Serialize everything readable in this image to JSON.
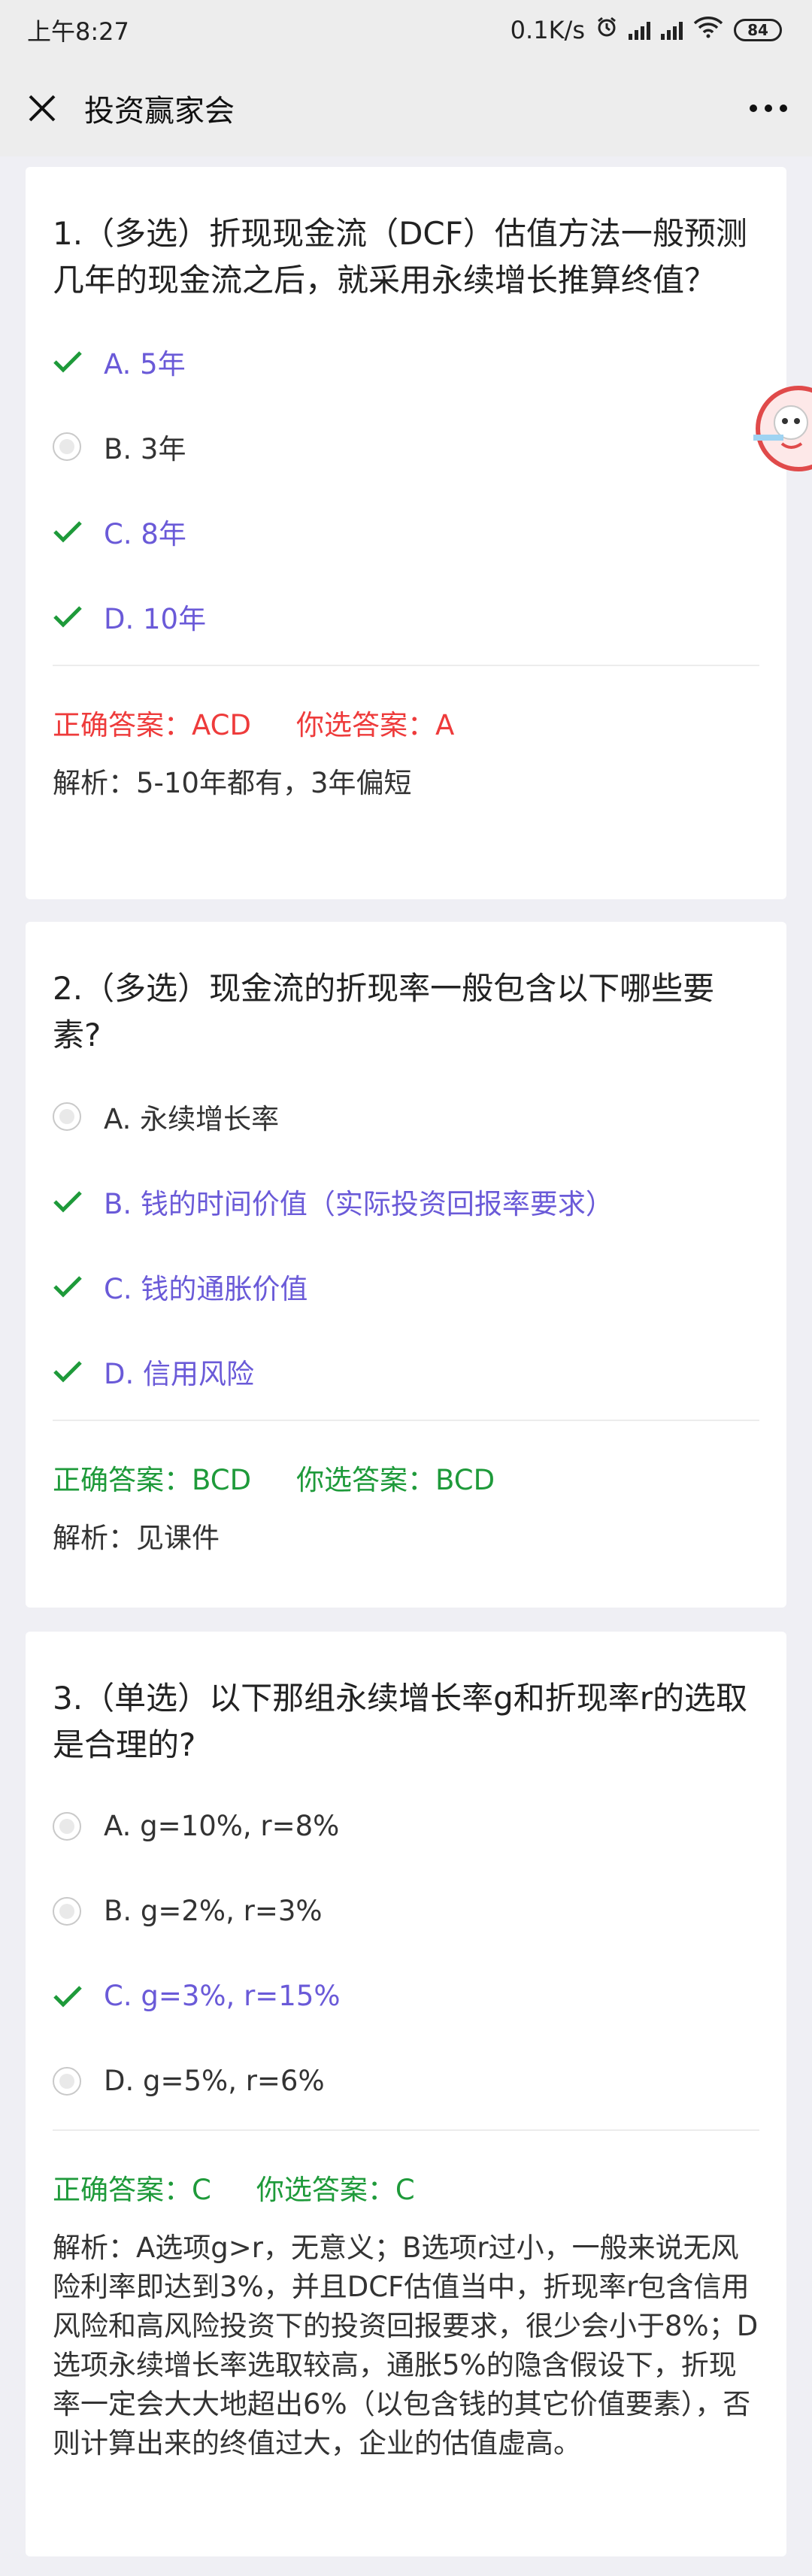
{
  "status_bar": {
    "time": "上午8:27",
    "net_speed": "0.1K/s",
    "battery": "84"
  },
  "nav": {
    "title": "投资赢家会"
  },
  "questions": [
    {
      "text": "1.（多选）折现现金流（DCF）估值方法一般预测几年的现金流之后，就采用永续增长推算终值？",
      "options": [
        {
          "label": "A. 5年",
          "selected": true
        },
        {
          "label": "B. 3年",
          "selected": false
        },
        {
          "label": "C. 8年",
          "selected": true
        },
        {
          "label": "D. 10年",
          "selected": true
        }
      ],
      "correct_answer": "正确答案：ACD",
      "your_answer": "你选答案：A",
      "analysis": "解析：5-10年都有，3年偏短"
    },
    {
      "text": "2.（多选）现金流的折现率一般包含以下哪些要素?",
      "options": [
        {
          "label": "A. 永续增长率",
          "selected": false
        },
        {
          "label": "B. 钱的时间价值（实际投资回报率要求）",
          "selected": true
        },
        {
          "label": "C. 钱的通胀价值",
          "selected": true
        },
        {
          "label": "D. 信用风险",
          "selected": true
        }
      ],
      "correct_answer": "正确答案：BCD",
      "your_answer": "你选答案：BCD",
      "analysis": "解析：见课件"
    },
    {
      "text": "3.（单选）以下那组永续增长率g和折现率r的选取是合理的?",
      "options": [
        {
          "label": "A. g=10%, r=8%",
          "selected": false
        },
        {
          "label": "B. g=2%, r=3%",
          "selected": false
        },
        {
          "label": "C. g=3%, r=15%",
          "selected": true
        },
        {
          "label": "D. g=5%, r=6%",
          "selected": false
        }
      ],
      "correct_answer": "正确答案：C",
      "your_answer": "你选答案：C",
      "analysis": "解析：A选项g>r，无意义；B选项r过小，一般来说无风险利率即达到3%，并且DCF估值当中，折现率r包含信用风险和高风险投资下的投资回报要求，很少会小于8%；D选项永续增长率选取较高，通胀5%的隐含假设下，折现率一定会大大地超出6%（以包含钱的其它价值要素），否则计算出来的终值过大，企业的估值虚高。"
    }
  ],
  "colors": {
    "selected_option": "#6a5ad8",
    "check": "#1e9a3a",
    "wrong": "#ee3b3b",
    "correct": "#1e9a3a",
    "background": "#efeff4"
  }
}
